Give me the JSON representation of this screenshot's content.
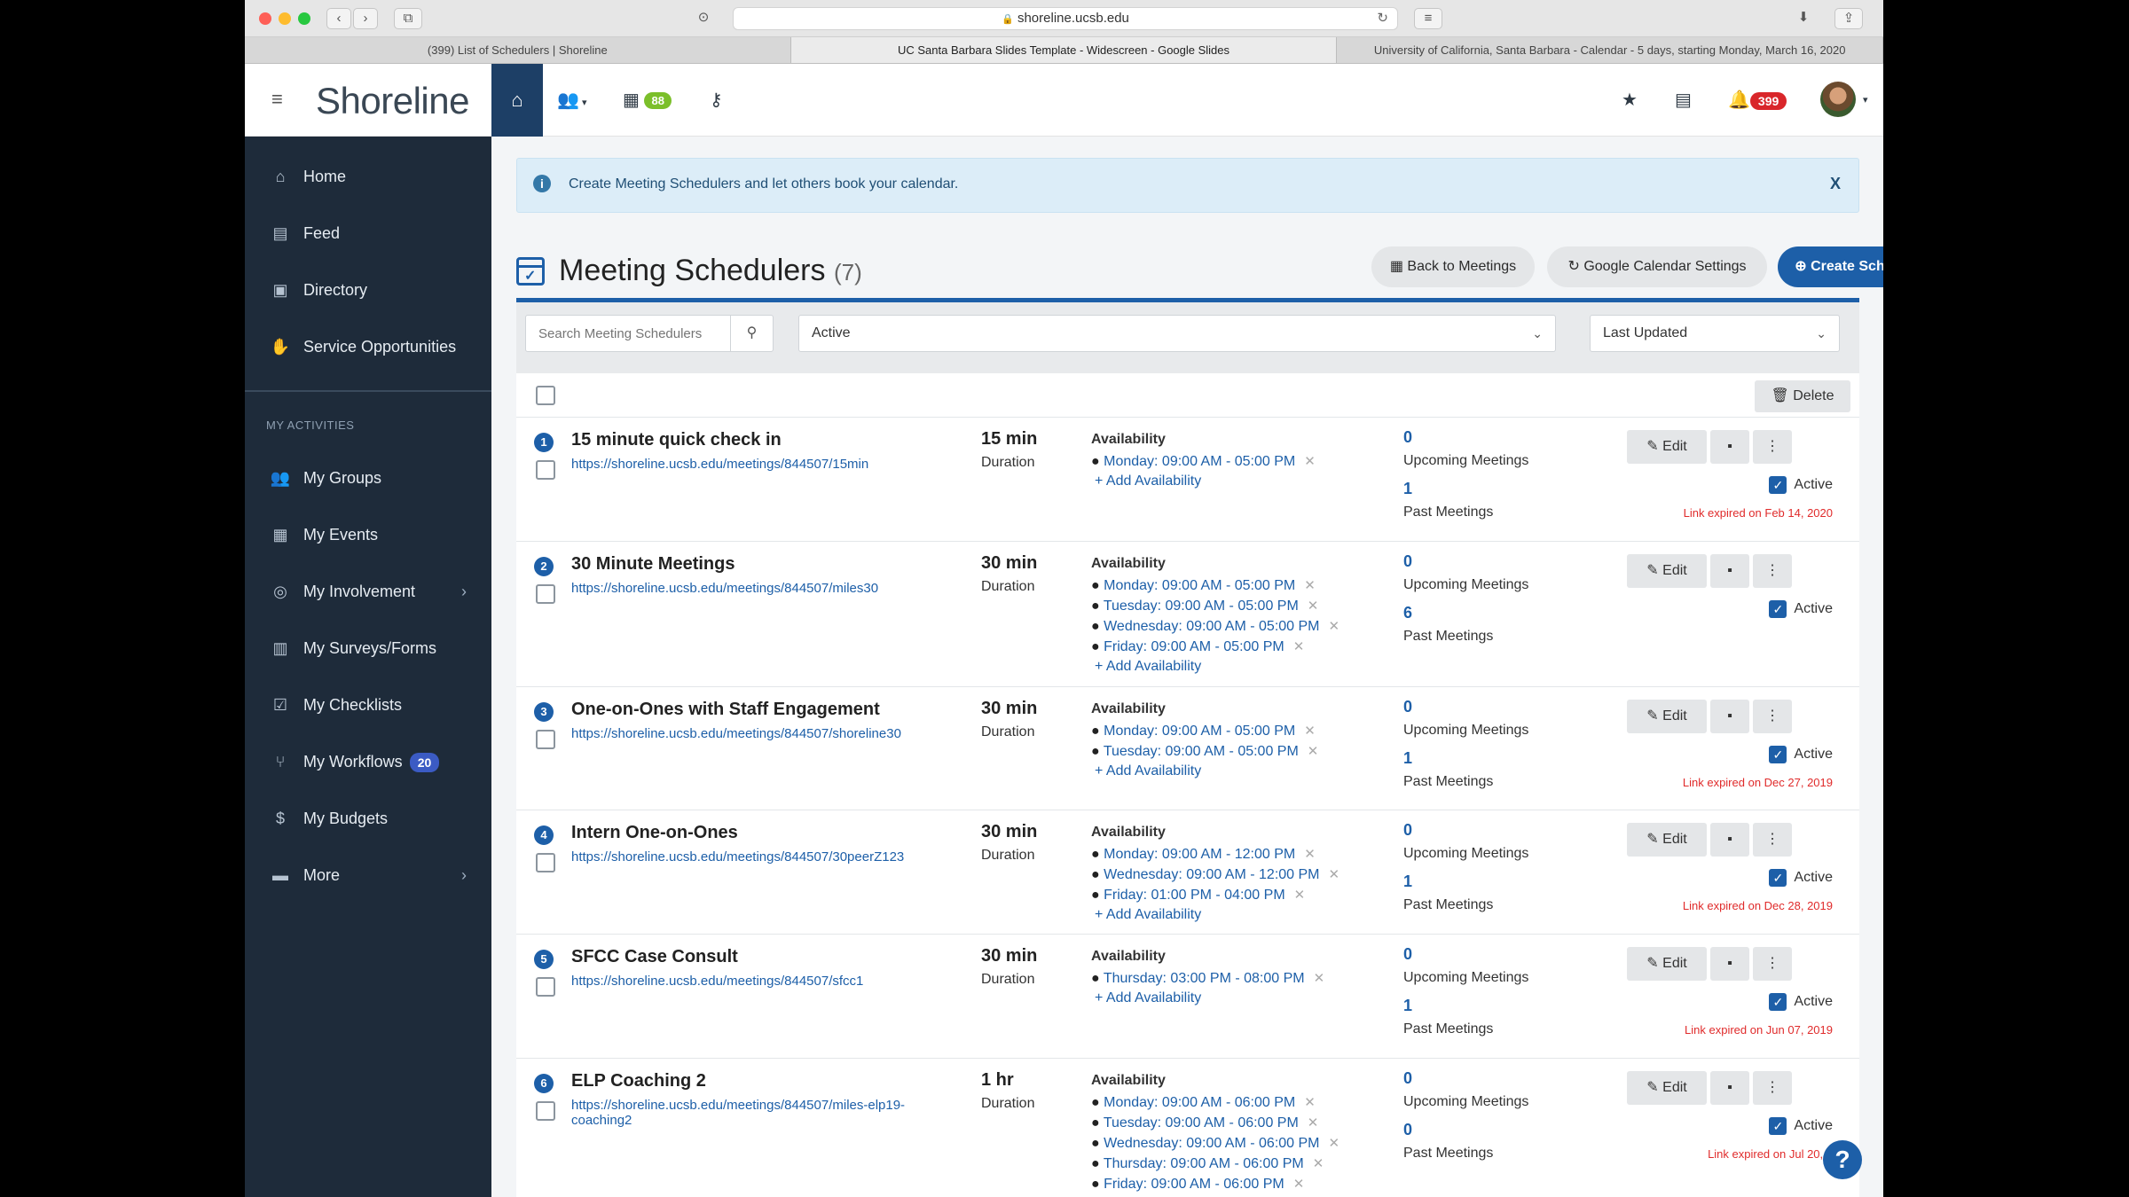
{
  "browser": {
    "url": "shoreline.ucsb.edu",
    "tabs": [
      "(399) List of Schedulers | Shoreline",
      "UC Santa Barbara Slides Template - Widescreen - Google Slides",
      "University of California, Santa Barbara - Calendar - 5 days, starting Monday, March 16, 2020"
    ]
  },
  "header": {
    "logo": "Shoreline",
    "calendar_badge": "88",
    "notif_badge": "399"
  },
  "sidebar": {
    "items": [
      "Home",
      "Feed",
      "Directory",
      "Service Opportunities"
    ],
    "section_label": "MY ACTIVITIES",
    "activities": [
      "My Groups",
      "My Events",
      "My Involvement",
      "My Surveys/Forms",
      "My Checklists",
      "My Workflows",
      "My Budgets",
      "More"
    ],
    "workflows_badge": "20"
  },
  "alert": {
    "text": "Create Meeting Schedulers and let others book your calendar.",
    "close": "X"
  },
  "page": {
    "title": "Meeting Schedulers",
    "count": "(7)",
    "back_btn": "Back to Meetings",
    "gcal_btn": "Google Calendar Settings",
    "create_btn": "Create Scheduler"
  },
  "filters": {
    "search_placeholder": "Search Meeting Schedulers",
    "status": "Active",
    "sort": "Last Updated"
  },
  "list": {
    "delete_label": "Delete",
    "labels": {
      "duration": "Duration",
      "availability": "Availability",
      "add_availability": "Add Availability",
      "upcoming": "Upcoming Meetings",
      "past": "Past Meetings",
      "edit": "Edit",
      "active": "Active"
    }
  },
  "rows": [
    {
      "num": "1",
      "title": "15 minute quick check in",
      "link": "https://shoreline.ucsb.edu/meetings/844507/15min",
      "duration": "15 min",
      "avail": [
        "Monday: 09:00 AM - 05:00 PM"
      ],
      "upcoming": "0",
      "past": "1",
      "expired": "Link expired on Feb 14, 2020"
    },
    {
      "num": "2",
      "title": "30 Minute Meetings",
      "link": "https://shoreline.ucsb.edu/meetings/844507/miles30",
      "duration": "30 min",
      "avail": [
        "Monday: 09:00 AM - 05:00 PM",
        "Tuesday: 09:00 AM - 05:00 PM",
        "Wednesday: 09:00 AM - 05:00 PM",
        "Friday: 09:00 AM - 05:00 PM"
      ],
      "upcoming": "0",
      "past": "6",
      "expired": ""
    },
    {
      "num": "3",
      "title": "One-on-Ones with Staff Engagement",
      "link": "https://shoreline.ucsb.edu/meetings/844507/shoreline30",
      "duration": "30 min",
      "avail": [
        "Monday: 09:00 AM - 05:00 PM",
        "Tuesday: 09:00 AM - 05:00 PM"
      ],
      "upcoming": "0",
      "past": "1",
      "expired": "Link expired on Dec 27, 2019"
    },
    {
      "num": "4",
      "title": "Intern One-on-Ones",
      "link": "https://shoreline.ucsb.edu/meetings/844507/30peerZ123",
      "duration": "30 min",
      "avail": [
        "Monday: 09:00 AM - 12:00 PM",
        "Wednesday: 09:00 AM - 12:00 PM",
        "Friday: 01:00 PM - 04:00 PM"
      ],
      "upcoming": "0",
      "past": "1",
      "expired": "Link expired on Dec 28, 2019"
    },
    {
      "num": "5",
      "title": "SFCC Case Consult",
      "link": "https://shoreline.ucsb.edu/meetings/844507/sfcc1",
      "duration": "30 min",
      "avail": [
        "Thursday: 03:00 PM - 08:00 PM"
      ],
      "upcoming": "0",
      "past": "1",
      "expired": "Link expired on Jun 07, 2019"
    },
    {
      "num": "6",
      "title": "ELP Coaching 2",
      "link": "https://shoreline.ucsb.edu/meetings/844507/miles-elp19-coaching2",
      "duration": "1 hr",
      "avail": [
        "Monday: 09:00 AM - 06:00 PM",
        "Tuesday: 09:00 AM - 06:00 PM",
        "Wednesday: 09:00 AM - 06:00 PM",
        "Thursday: 09:00 AM - 06:00 PM",
        "Friday: 09:00 AM - 06:00 PM"
      ],
      "upcoming": "0",
      "past": "0",
      "expired": "Link expired on Jul 20, 2"
    }
  ]
}
